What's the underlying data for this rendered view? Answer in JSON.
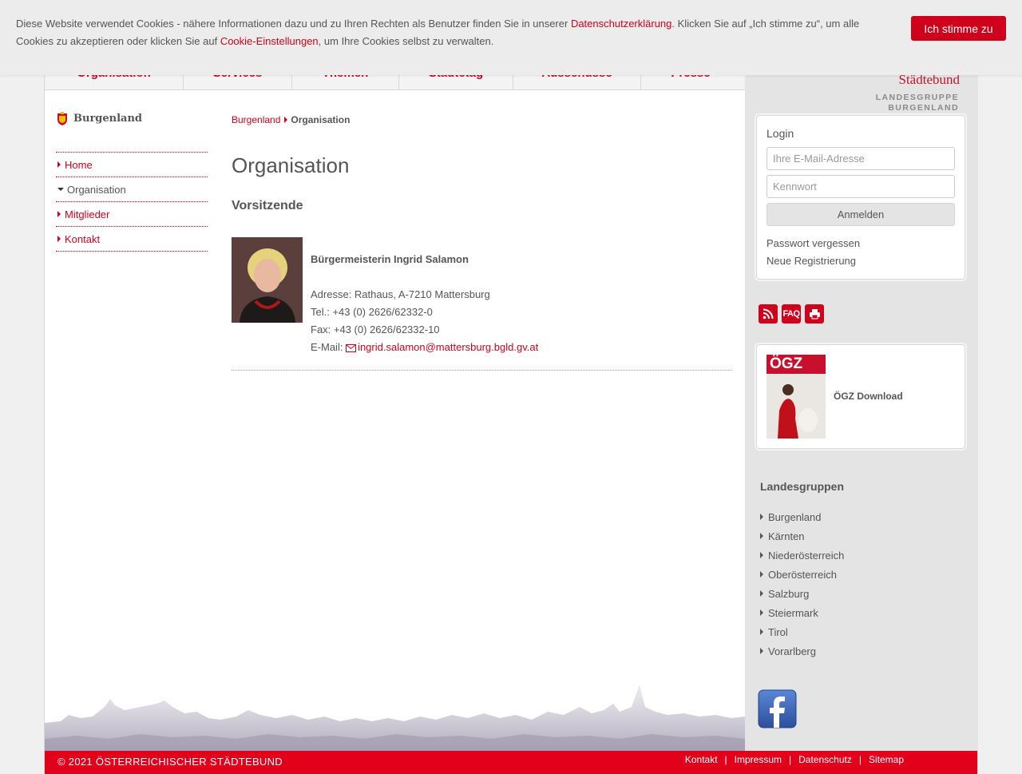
{
  "cookie": {
    "text_before": "Diese Website verwendet Cookies - nähere Informationen dazu und zu Ihren Rechten als Benutzer finden Sie in unserer ",
    "privacy_link": "Datenschutzerklärung",
    "text_middle": ". Klicken Sie auf „Ich stimme zu“, um alle Cookies zu akzeptieren oder klicken Sie auf ",
    "settings_link": "Cookie-Einstellungen",
    "text_after": ", um Ihre Cookies selbst zu verwalten.",
    "accept_label": "Ich stimme zu"
  },
  "nav": {
    "items": [
      "Organisation",
      "Services",
      "Themen",
      "Städtetag",
      "Ausschüsse",
      "Presse"
    ]
  },
  "logo": {
    "brand": "Städtebund",
    "sub_line1": "LANDESGRUPPE",
    "sub_line2": "BURGENLAND"
  },
  "sidebar": {
    "region": "Burgenland",
    "items": [
      {
        "label": "Home",
        "active": false
      },
      {
        "label": "Organisation",
        "active": true
      },
      {
        "label": "Mitglieder",
        "active": false
      },
      {
        "label": "Kontakt",
        "active": false
      }
    ]
  },
  "breadcrumb": {
    "parent": "Burgenland",
    "current": "Organisation"
  },
  "main": {
    "title": "Organisation",
    "section": "Vorsitzende",
    "person": {
      "name": "Bürgermeisterin Ingrid Salamon",
      "address": "Adresse: Rathaus, A-7210 Mattersburg",
      "tel": "Tel.: +43 (0) 2626/62332-0",
      "fax": "Fax: +43 (0) 2626/62332-10",
      "email_label": "E-Mail: ",
      "email": "ingrid.salamon@mattersburg.bgld.gv.at"
    }
  },
  "login": {
    "title": "Login",
    "email_placeholder": "Ihre E-Mail-Adresse",
    "password_placeholder": "Kennwort",
    "submit_label": "Anmelden",
    "forgot_label": "Passwort vergessen",
    "register_label": "Neue Registrierung"
  },
  "icons": {
    "faq_label": "FAQ"
  },
  "ogz": {
    "cover_title": "ÖGZ",
    "link_label": "ÖGZ Download"
  },
  "landesgruppen": {
    "title": "Landesgruppen",
    "items": [
      "Burgenland",
      "Kärnten",
      "Niederösterreich",
      "Oberösterreich",
      "Salzburg",
      "Steiermark",
      "Tirol",
      "Vorarlberg"
    ]
  },
  "footer": {
    "copyright": "©  2021  ÖSTERREICHISCHER STÄDTEBUND",
    "links": [
      "Kontakt",
      "Impressum",
      "Datenschutz",
      "Sitemap"
    ]
  },
  "colors": {
    "accent": "#d0021b",
    "footer_bg": "#e2001a",
    "sidebar_bg": "#e4e4e4"
  }
}
